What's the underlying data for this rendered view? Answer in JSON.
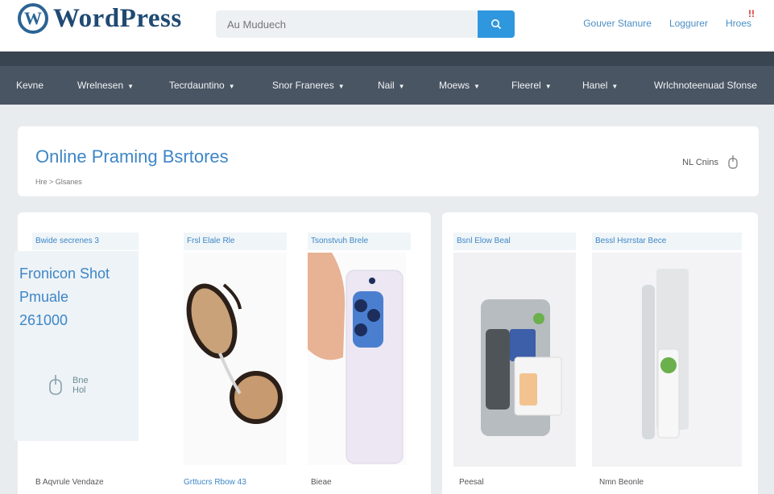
{
  "header": {
    "logo_text": "WordPress",
    "logo_letter": "W",
    "search_placeholder": "Au Muduech",
    "links": [
      "Gouver Stanure",
      "Loggurer"
    ],
    "cart_label": "Hroes",
    "cart_badge": "!!"
  },
  "nav": {
    "items": [
      {
        "label": "Kevne",
        "caret": false
      },
      {
        "label": "Wrelnesen",
        "caret": true
      },
      {
        "label": "Tecrdauntino",
        "caret": true
      },
      {
        "label": "Snor Franeres",
        "caret": true
      },
      {
        "label": "Nail",
        "caret": true
      },
      {
        "label": "Moews",
        "caret": true
      },
      {
        "label": "Fleerel",
        "caret": true
      },
      {
        "label": "Hanel",
        "caret": true
      },
      {
        "label": "Wrlchnoteenuad Sfonse",
        "caret": false
      }
    ]
  },
  "page": {
    "title": "Online Praming Bsrtores",
    "breadcrumb": "Hre  >  Glsanes",
    "right_label": "NL Cnins"
  },
  "promo": {
    "header": "Bwide secrenes 3",
    "line1": "Fronicon Shot",
    "line2": "Pmuale",
    "line3": "261000",
    "icon_text_1": "Bne",
    "icon_text_2": "Hol"
  },
  "cards": [
    {
      "header": "Frsl Elale Rle",
      "footer": "Grttucrs Rbow 43"
    },
    {
      "header": "Tsonstvuh Brele",
      "footer": "Bieae"
    },
    {
      "header": "Bsnl Elow Beal",
      "footer": "Peesal"
    },
    {
      "header": "Bessl Hsrrstar Bece",
      "footer": "Nmn Beonle"
    }
  ],
  "promo_footer": "B Aqvrule Vendaze",
  "colors": {
    "accent": "#3d86c6",
    "search_button": "#2f97dd",
    "navbar": "#4a5563",
    "navbar_dark": "#3a4552",
    "background": "#e9ecef"
  }
}
